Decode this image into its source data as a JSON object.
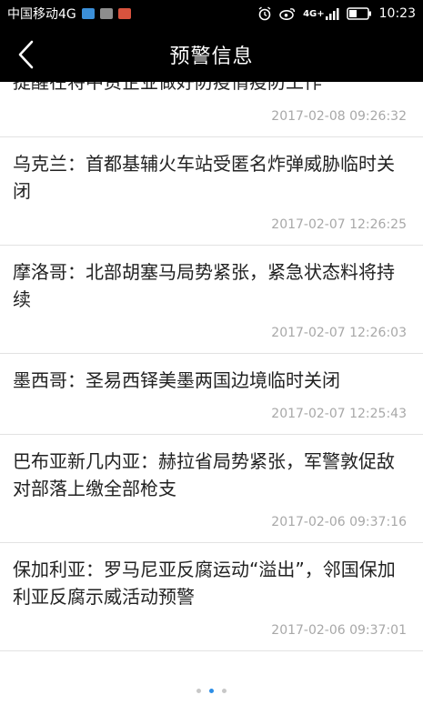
{
  "status_bar": {
    "carrier": "中国移动4G",
    "network": "4G+",
    "time": "10:23",
    "colors": {
      "blue": "#3b8fd8",
      "gray": "#8d8d8d",
      "red": "#d8533e"
    }
  },
  "header": {
    "title": "预警信息",
    "back_icon": "chevron-left-icon"
  },
  "alerts": [
    {
      "title": "提醒在将中资企业做好防疫情疫防工作",
      "time": "2017-02-08 09:26:32"
    },
    {
      "title": "乌克兰：首都基辅火车站受匿名炸弹威胁临时关闭",
      "time": "2017-02-07 12:26:25"
    },
    {
      "title": "摩洛哥：北部胡塞马局势紧张，紧急状态料将持续",
      "time": "2017-02-07 12:26:03"
    },
    {
      "title": "墨西哥：圣易西铎美墨两国边境临时关闭",
      "time": "2017-02-07 12:25:43"
    },
    {
      "title": "巴布亚新几内亚：赫拉省局势紧张，军警敦促敌对部落上缴全部枪支",
      "time": "2017-02-06 09:37:16"
    },
    {
      "title": "保加利亚：罗马尼亚反腐运动“溢出”，邻国保加利亚反腐示威活动预警",
      "time": "2017-02-06 09:37:01"
    }
  ],
  "pagination": {
    "total": 3,
    "active_index": 1,
    "active_color": "#2d8ee6"
  }
}
